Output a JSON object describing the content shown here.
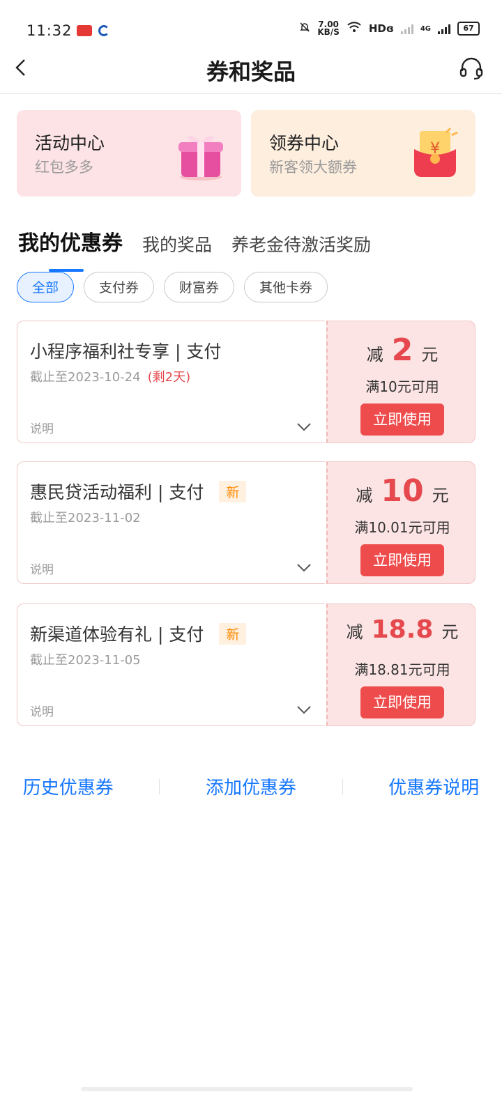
{
  "status": {
    "time": "11:32",
    "speed": "7.00",
    "speed_unit": "KB/S",
    "hd": "HDɞ",
    "net": "4G",
    "battery": "67"
  },
  "header": {
    "title": "券和奖品"
  },
  "cards": [
    {
      "title": "活动中心",
      "subtitle": "红包多多",
      "icon": "gift-box-icon"
    },
    {
      "title": "领券中心",
      "subtitle": "新客领大额券",
      "icon": "red-envelope-icon"
    }
  ],
  "tabs": [
    "我的优惠券",
    "我的奖品",
    "养老金待激活奖励"
  ],
  "chips": [
    "全部",
    "支付券",
    "财富券",
    "其他卡券"
  ],
  "coupons": [
    {
      "name": "小程序福利社专享 | 支付",
      "tag": "",
      "date": "截止至2023-10-24",
      "remaining": "(剩2天)",
      "note": "说明",
      "prefix": "减",
      "amount": "2",
      "unit": "元",
      "condition": "满10元可用",
      "button": "立即使用"
    },
    {
      "name": "惠民贷活动福利 | 支付",
      "tag": "新",
      "date": "截止至2023-11-02",
      "remaining": "",
      "note": "说明",
      "prefix": "减",
      "amount": "10",
      "unit": "元",
      "condition": "满10.01元可用",
      "button": "立即使用"
    },
    {
      "name": "新渠道体验有礼 | 支付",
      "tag": "新",
      "date": "截止至2023-11-05",
      "remaining": "",
      "note": "说明",
      "prefix": "减",
      "amount": "18.8",
      "unit": "元",
      "condition": "满18.81元可用",
      "button": "立即使用"
    }
  ],
  "links": [
    "历史优惠券",
    "添加优惠券",
    "优惠券说明"
  ],
  "colors": {
    "accent": "#1677ff",
    "coupon_red": "#e5484d",
    "button_red": "#ee4c4c"
  }
}
